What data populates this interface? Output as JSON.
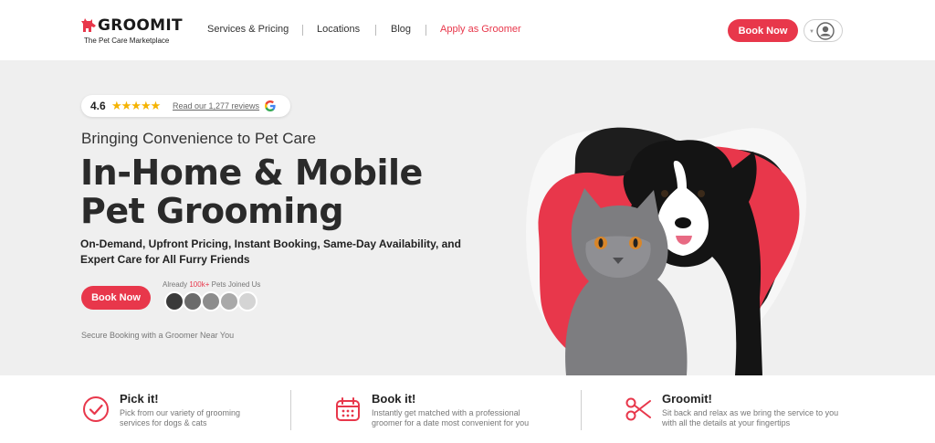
{
  "brand": {
    "name": "GROOMIT",
    "tagline": "The Pet Care Marketplace",
    "accent_color": "#e8374b"
  },
  "nav": {
    "items": [
      {
        "label": "Services & Pricing"
      },
      {
        "label": "Locations"
      },
      {
        "label": "Blog"
      },
      {
        "label": "Apply as Groomer"
      }
    ],
    "book_label": "Book Now",
    "user_icon": "user-circle-icon"
  },
  "hero": {
    "rating_value": "4.6",
    "stars": "★★★★★",
    "reviews_label": "Read our 1,277 reviews",
    "subtitle": "Bringing Convenience to Pet Care",
    "headline_line1": "In-Home & Mobile",
    "headline_line2": "Pet Grooming",
    "description": "On-Demand, Upfront Pricing, Instant Booking, Same-Day Availability, and Expert Care for All Furry Friends",
    "cta_label": "Book Now",
    "joined_prefix": "Already",
    "joined_count": "100k+",
    "joined_suffix": "Pets Joined Us",
    "secure_text": "Secure Booking with a Groomer Near You"
  },
  "features": [
    {
      "title": "Pick it!",
      "text": "Pick from our variety of grooming services for dogs & cats",
      "icon": "check-circle-icon"
    },
    {
      "title": "Book it!",
      "text": "Instantly get matched with a professional groomer for a date most convenient for you",
      "icon": "calendar-icon"
    },
    {
      "title": "Groomit!",
      "text": "Sit back and relax as we bring the service to you with all the details at your fingertips",
      "icon": "scissors-icon"
    }
  ]
}
